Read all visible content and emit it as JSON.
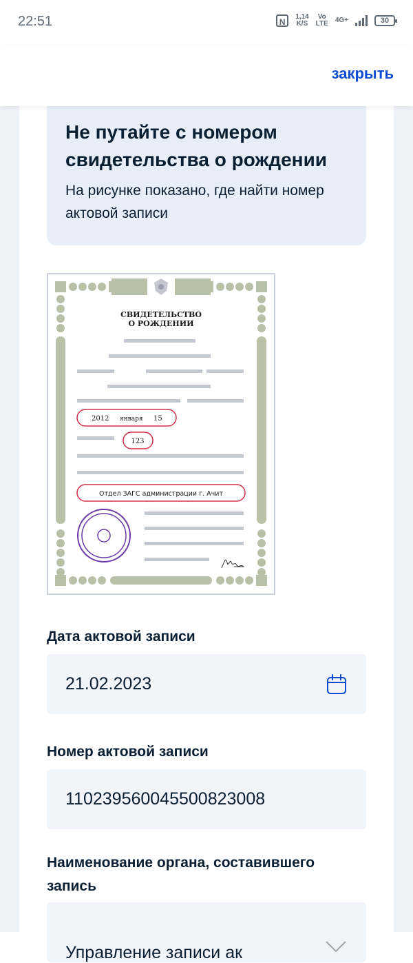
{
  "status_bar": {
    "time": "22:51",
    "speed_value": "1,14",
    "speed_unit": "K/S",
    "volte_top": "Vo",
    "volte_bottom": "LTE",
    "network": "4G+",
    "battery": "30"
  },
  "header": {
    "close_label": "закрыть"
  },
  "info_card": {
    "title": "Не путайте с номером свидетельства о рождении",
    "text": "На рисунке показано, где найти номер актовой записи"
  },
  "certificate": {
    "title_line1": "СВИДЕТЕЛЬСТВО",
    "title_line2": "О РОЖДЕНИИ",
    "date_year": "2012",
    "date_month": "января",
    "date_day": "15",
    "record_number": "123",
    "registry_office": "Отдел ЗАГС администрации г. Ачит"
  },
  "form": {
    "date_label": "Дата актовой записи",
    "date_value": "21.02.2023",
    "number_label": "Номер актовой записи",
    "number_value": "110239560045500823008",
    "authority_label": "Наименование органа, составившего запись",
    "authority_value": "Управление записи ак"
  },
  "colors": {
    "accent": "#0d4cd3",
    "card_bg": "#e8eef8",
    "field_bg": "#f1f4f8",
    "highlight": "#d3304a",
    "ornament": "#b9c0a8",
    "seal": "#6b3aa8"
  }
}
